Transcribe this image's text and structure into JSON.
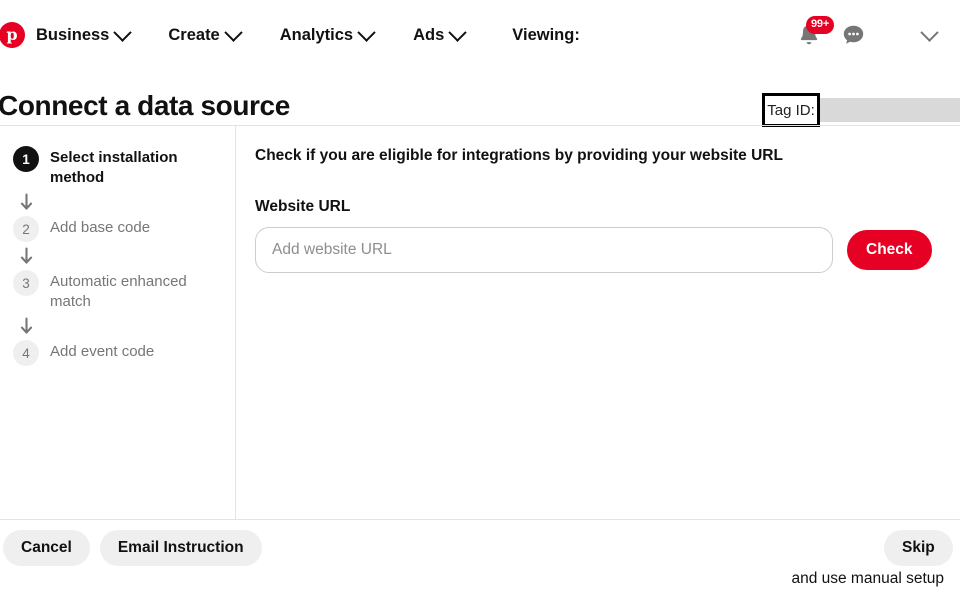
{
  "header": {
    "logo_icon": "pinterest-logo-icon",
    "logo_letter": "p",
    "nav": [
      {
        "label": "Business",
        "icon": "chevron-down-icon"
      },
      {
        "label": "Create",
        "icon": "chevron-down-icon"
      },
      {
        "label": "Analytics",
        "icon": "chevron-down-icon"
      },
      {
        "label": "Ads",
        "icon": "chevron-down-icon"
      }
    ],
    "viewing_label": "Viewing:",
    "viewing_value": "",
    "notifications": {
      "icon": "bell-icon",
      "badge_count": "99+"
    },
    "messages": {
      "icon": "messages-bubble-icon"
    },
    "account_menu": {
      "icon": "chevron-down-icon"
    }
  },
  "page": {
    "title": "Connect a data source",
    "tag_id_label": "Tag ID:",
    "tag_id_value": ""
  },
  "stepper": {
    "steps": [
      {
        "number": "1",
        "label": "Select installation method",
        "state": "active"
      },
      {
        "number": "2",
        "label": "Add base code",
        "state": "inactive"
      },
      {
        "number": "3",
        "label": "Automatic enhanced match",
        "state": "inactive"
      },
      {
        "number": "4",
        "label": "Add event code",
        "state": "inactive"
      }
    ],
    "connector_icon": "arrow-down-icon"
  },
  "main": {
    "heading": "Check if you are eligible for integrations by providing your website URL",
    "field_label": "Website URL",
    "url_placeholder": "Add website URL",
    "url_value": "",
    "check_label": "Check"
  },
  "footer": {
    "cancel_label": "Cancel",
    "email_instruction_label": "Email Instruction",
    "skip_label": "Skip",
    "skip_subtext": "and use manual setup"
  },
  "colors": {
    "brand_red": "#e60023",
    "active_step": "#111111",
    "inactive_step_bg": "#efefef",
    "muted_text": "#767676",
    "divider": "#e3e3e3",
    "redaction": "#d9d9d9"
  }
}
